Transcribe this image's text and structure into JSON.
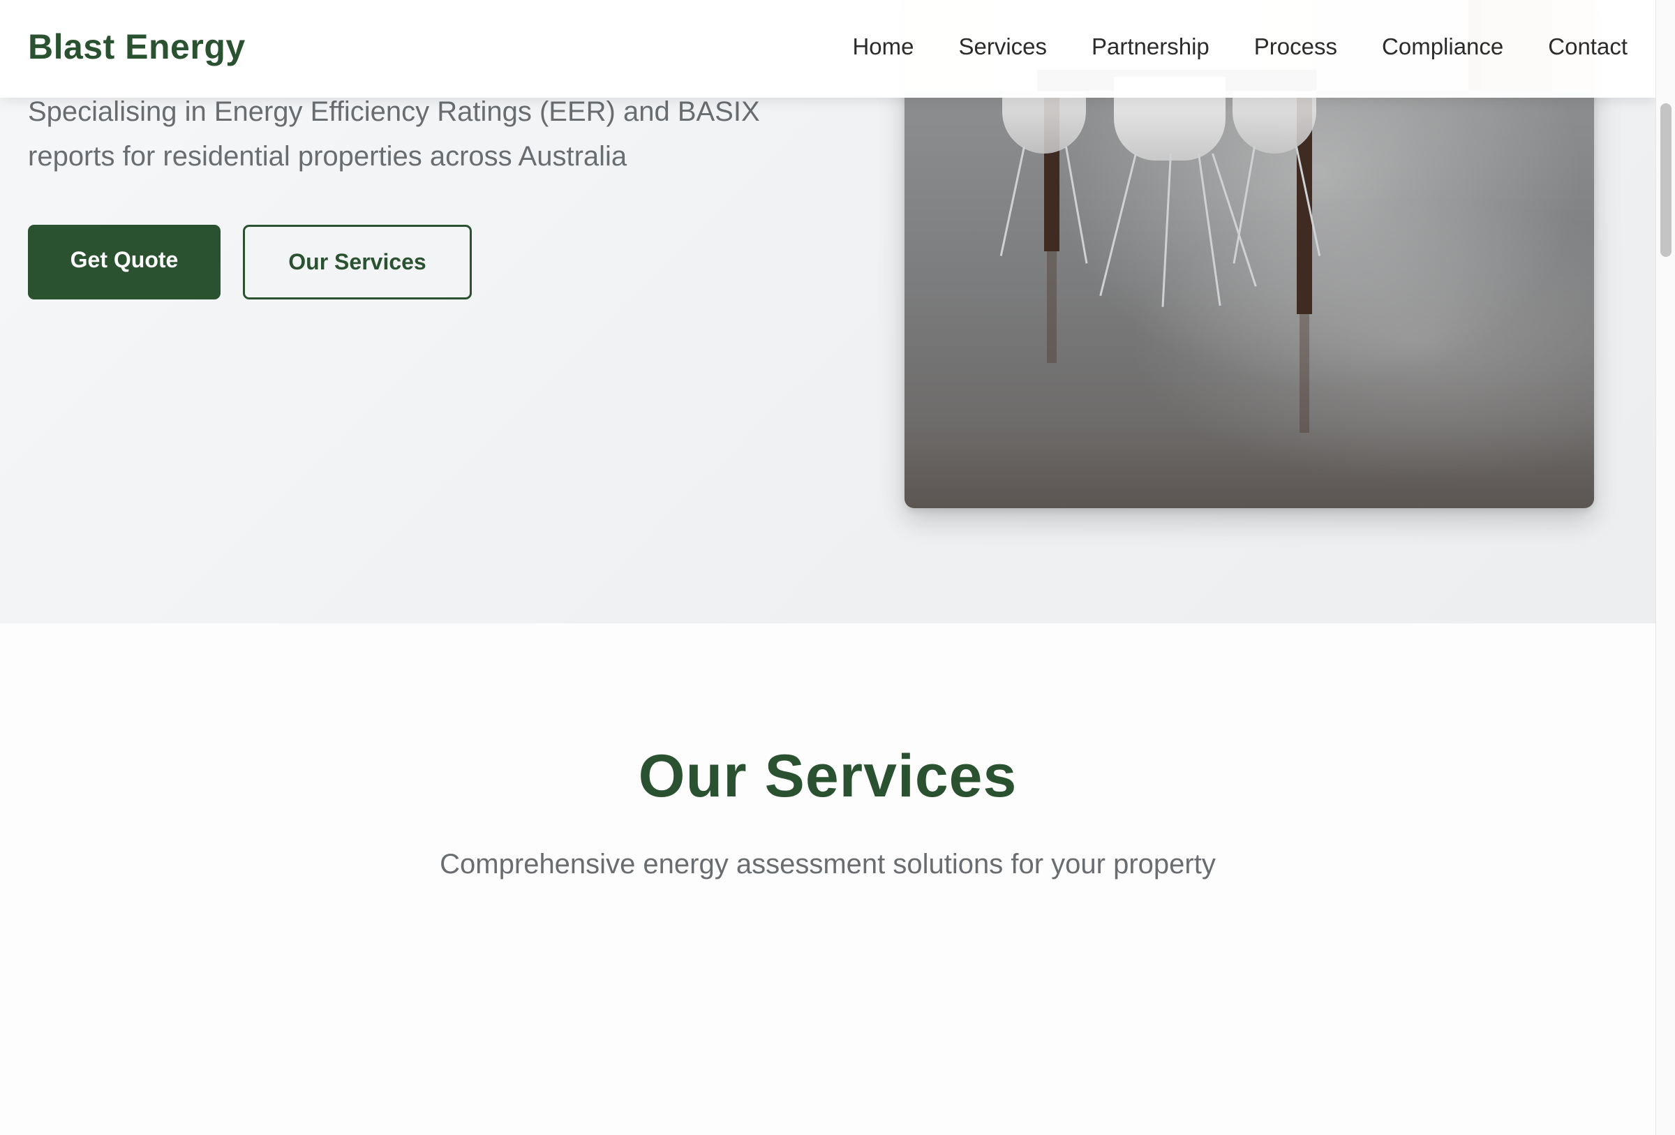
{
  "brand": {
    "name": "Blast Energy",
    "color": "#2a5230"
  },
  "nav": {
    "items": [
      {
        "label": "Home"
      },
      {
        "label": "Services"
      },
      {
        "label": "Partnership"
      },
      {
        "label": "Process"
      },
      {
        "label": "Compliance"
      },
      {
        "label": "Contact"
      }
    ]
  },
  "hero": {
    "subtitle": "Specialising in Energy Efficiency Ratings (EER) and BASIX reports for residential properties across Australia",
    "primary_button": "Get Quote",
    "secondary_button": "Our Services",
    "image_icon": "dining-room-photo"
  },
  "services": {
    "title": "Our Services",
    "subtitle": "Comprehensive energy assessment solutions for your property"
  }
}
